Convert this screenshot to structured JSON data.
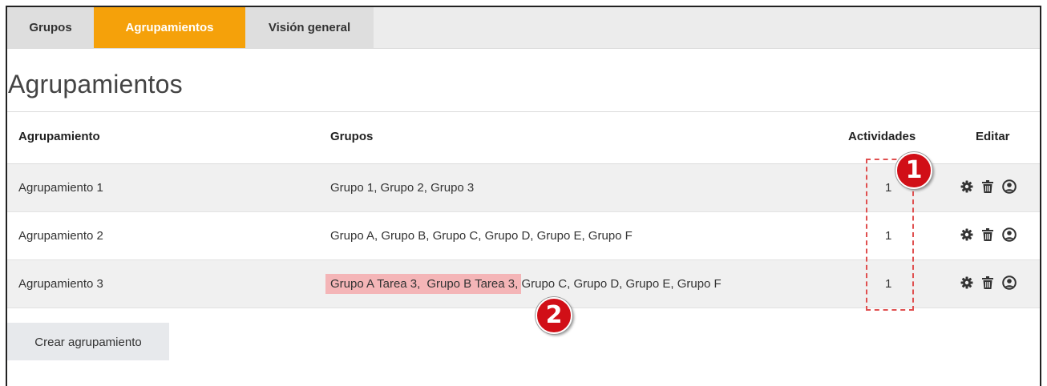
{
  "tabs": [
    {
      "label": "Grupos",
      "active": false
    },
    {
      "label": "Agrupamientos",
      "active": true
    },
    {
      "label": "Visión general",
      "active": false
    }
  ],
  "accent_color": "#f5a10a",
  "page_title": "Agrupamientos",
  "table": {
    "headers": {
      "agrupamiento": "Agrupamiento",
      "grupos": "Grupos",
      "actividades": "Actividades",
      "editar": "Editar"
    },
    "rows": [
      {
        "name": "Agrupamiento 1",
        "groups": "Grupo 1, Grupo 2, Grupo 3",
        "activities": "1"
      },
      {
        "name": "Agrupamiento 2",
        "groups": "Grupo A, Grupo B, Grupo C, Grupo D, Grupo E, Grupo F",
        "activities": "1"
      },
      {
        "name": "Agrupamiento 3",
        "groups_highlight_1": "Grupo A Tarea 3,",
        "groups_highlight_2": "Grupo B Tarea 3,",
        "groups_rest": "Grupo C, Grupo D, Grupo E, Grupo F",
        "activities": "1"
      }
    ],
    "edit_icons": [
      "gear-icon",
      "trash-icon",
      "user-icon"
    ]
  },
  "create_button": "Crear agrupamiento",
  "annotations": {
    "badge_1": "1",
    "badge_2": "2",
    "highlight_color": "#f4b5b7",
    "badge_color": "#d10f17"
  }
}
